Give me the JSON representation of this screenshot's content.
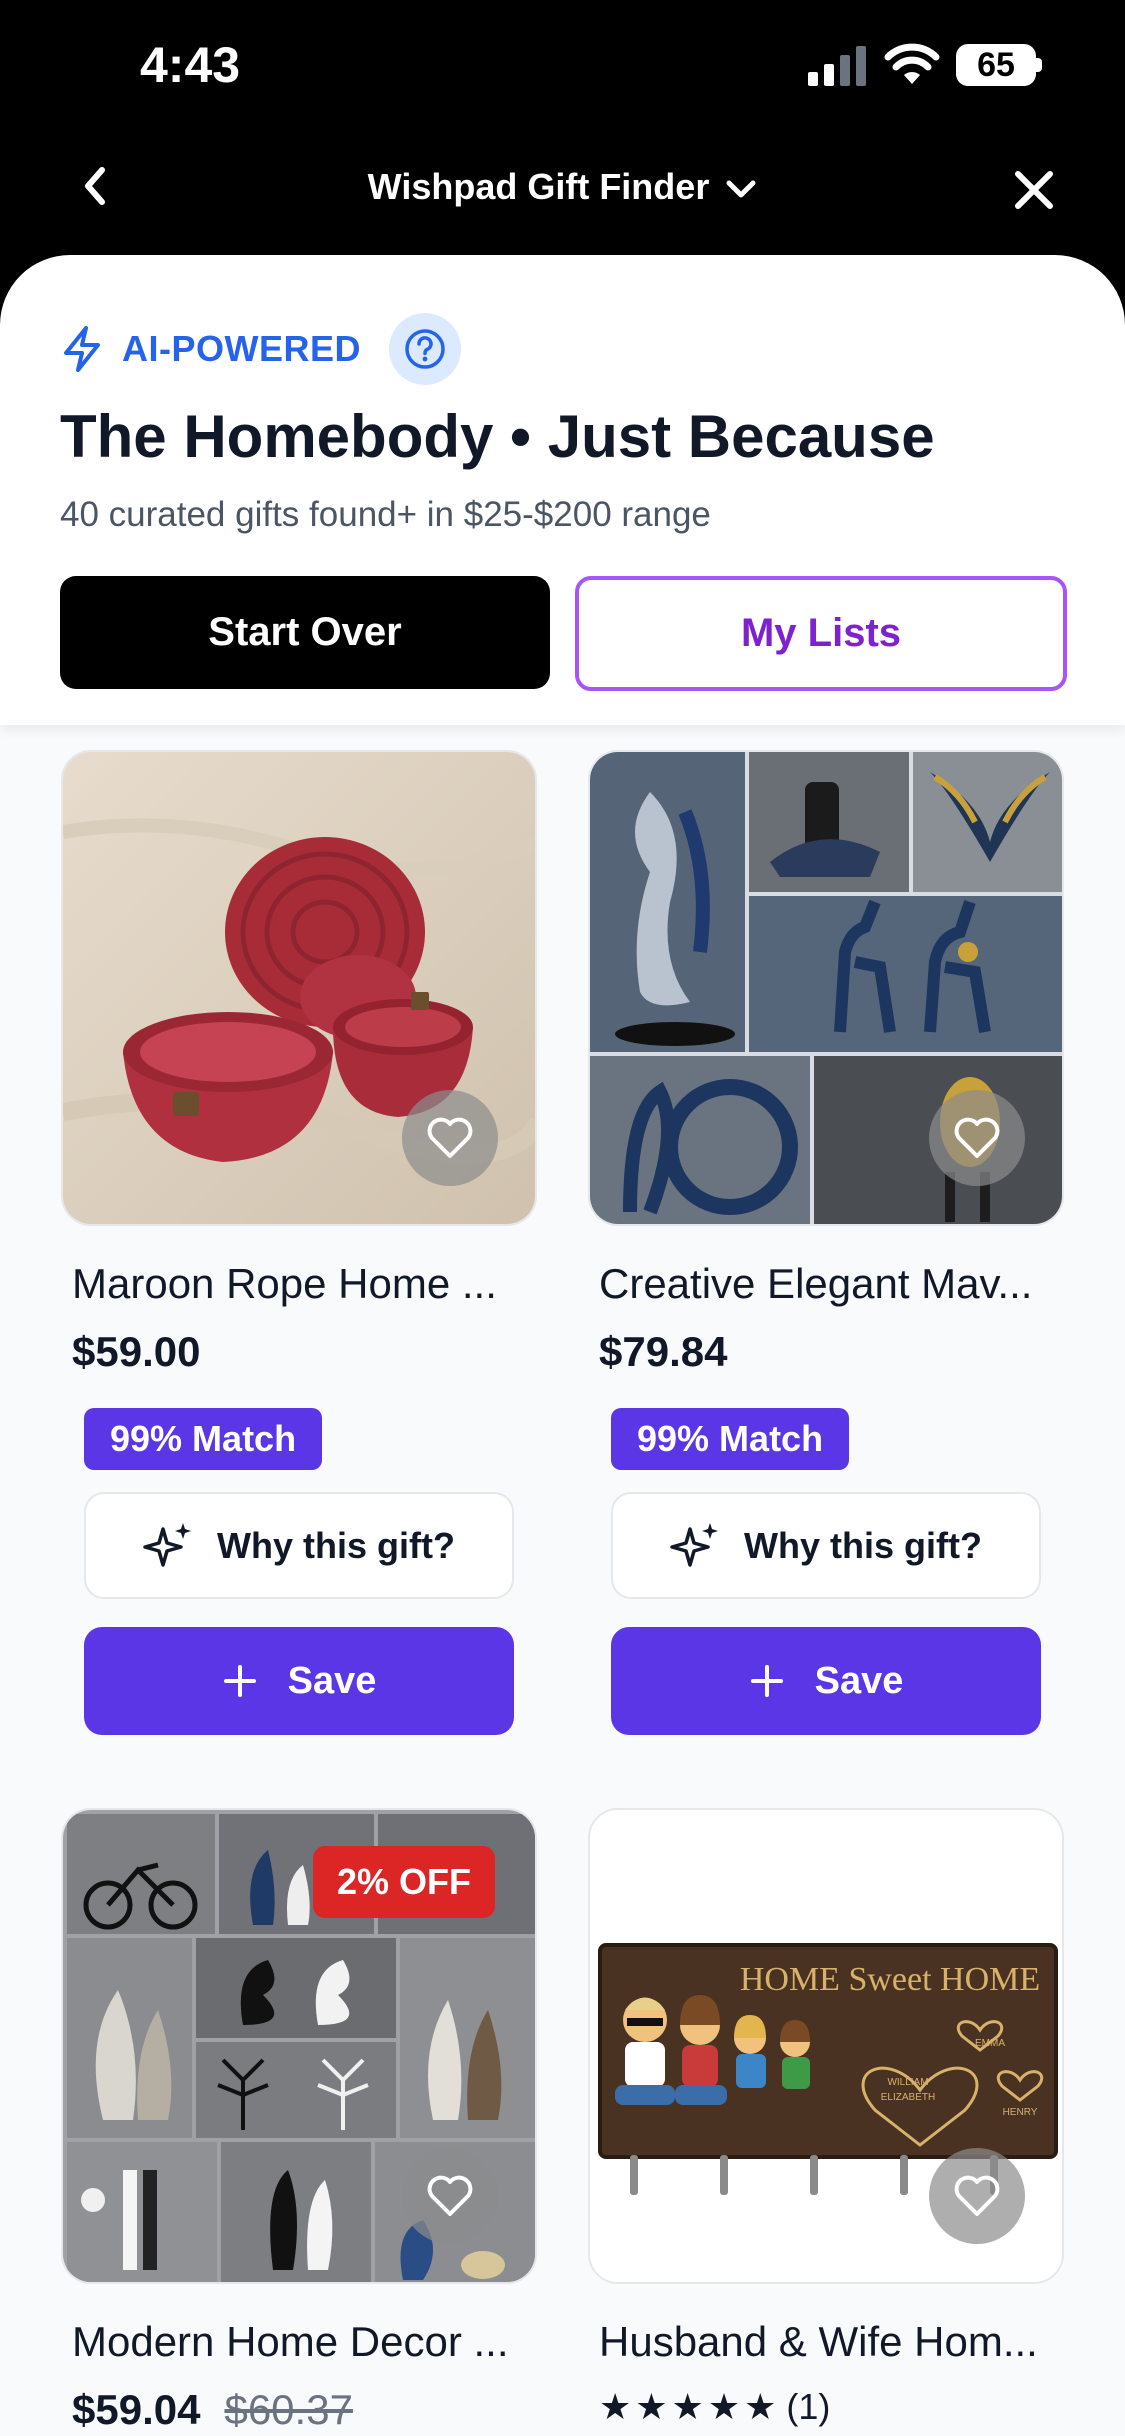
{
  "status_bar": {
    "time": "4:43",
    "battery": "65"
  },
  "nav": {
    "title": "Wishpad Gift Finder"
  },
  "header": {
    "ai_label": "AI-POWERED",
    "title": "The Homebody • Just Because",
    "subtitle": "40 curated gifts found+ in $25-$200 range",
    "start_over": "Start Over",
    "my_lists": "My Lists"
  },
  "colors": {
    "accent": "#5b36e6",
    "ai_blue": "#2563eb",
    "lists_border": "#a855f7",
    "badge_red": "#dc2626"
  },
  "products": [
    {
      "name": "Maroon Rope Home ...",
      "price": "$59.00",
      "match": "99% Match",
      "why": "Why this gift?",
      "save": "Save",
      "image": "red-rope-baskets-photo"
    },
    {
      "name": "Creative Elegant Mav...",
      "price": "$79.84",
      "match": "99% Match",
      "why": "Why this gift?",
      "save": "Save",
      "image": "blue-gold-sculptures-collage"
    },
    {
      "name": "Modern Home Decor ...",
      "price": "$59.04",
      "old_price": "$60.37",
      "discount": "2% OFF",
      "image": "home-decor-figurines-collage"
    },
    {
      "name": "Husband & Wife Hom...",
      "rating_stars": "★★★★★",
      "rating_count": "(1)",
      "image": "home-sweet-home-key-holder"
    }
  ],
  "plaque": {
    "text": "HOME Sweet HOME",
    "names": [
      "EMMA",
      "WILLIAM",
      "ELIZABETH",
      "HENRY"
    ]
  }
}
